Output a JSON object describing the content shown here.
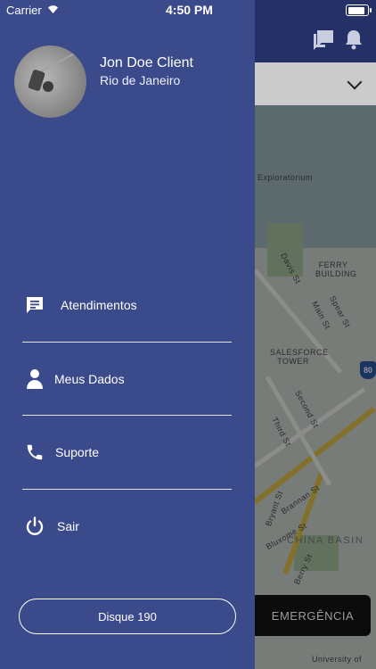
{
  "status_bar": {
    "carrier": "Carrier",
    "time": "4:50 PM"
  },
  "user": {
    "name": "Jon Doe Client",
    "city": "Rio de Janeiro"
  },
  "menu": [
    {
      "label": "Atendimentos",
      "icon": "chat-icon"
    },
    {
      "label": "Meus Dados",
      "icon": "person-icon"
    },
    {
      "label": "Suporte",
      "icon": "phone-icon"
    },
    {
      "label": "Sair",
      "icon": "power-icon"
    }
  ],
  "call_button": {
    "label": "Disque 190"
  },
  "emergency_button": {
    "label": "EMERGÊNCIA"
  },
  "map_labels": {
    "exploratorium": "Exploratorium",
    "ferry_building": "FERRY BUILDING",
    "salesforce_tower": "SALESFORCE TOWER",
    "second_st": "Second St",
    "third_st": "Third St",
    "brannan_st": "Brannan St",
    "bryant_st": "Bryant St",
    "china_basin": "CHINA BASIN",
    "university": "University of",
    "davis_st": "Davis St",
    "main_st": "Main St",
    "spear_st": "Spear St",
    "berry_st": "Berry St",
    "bluxome_st": "Bluxome St",
    "highway": "80"
  },
  "colors": {
    "drawer": "#3b4a8a",
    "topbar": "#243066",
    "emergency": "#0b0b0b"
  }
}
